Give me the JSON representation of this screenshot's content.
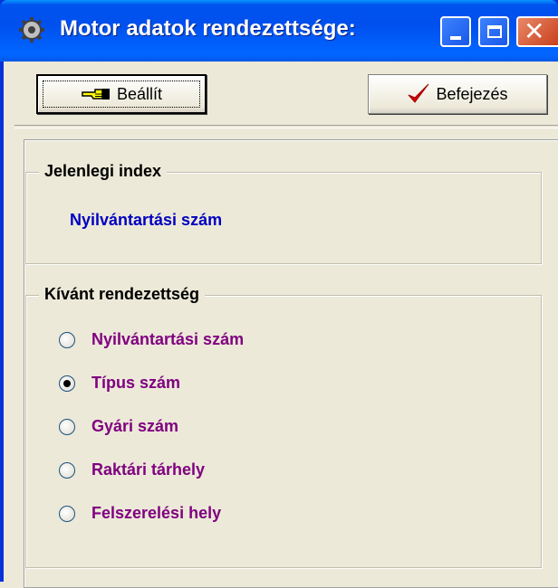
{
  "window": {
    "title": "Motor adatok rendezettsége:",
    "icon": "gear-icon"
  },
  "toolbar": {
    "set_label": "Beállít",
    "set_icon": "hand-pointer-icon",
    "finish_label": "Befejezés",
    "finish_icon": "checkmark-icon"
  },
  "current_index": {
    "legend": "Jelenlegi index",
    "value": "Nyilvántartási szám"
  },
  "sort_order": {
    "legend": "Kívánt rendezettség",
    "selected": "Típus szám",
    "options": [
      {
        "label": "Nyilvántartási szám",
        "checked": false
      },
      {
        "label": "Típus szám",
        "checked": true
      },
      {
        "label": "Gyári szám",
        "checked": false
      },
      {
        "label": "Raktári tárhely",
        "checked": false
      },
      {
        "label": "Felszerelési hely",
        "checked": false
      }
    ]
  },
  "colors": {
    "titlebar": "#0054e3",
    "current_value": "#0000c0",
    "option_text": "#800080",
    "check": "#d40000"
  }
}
